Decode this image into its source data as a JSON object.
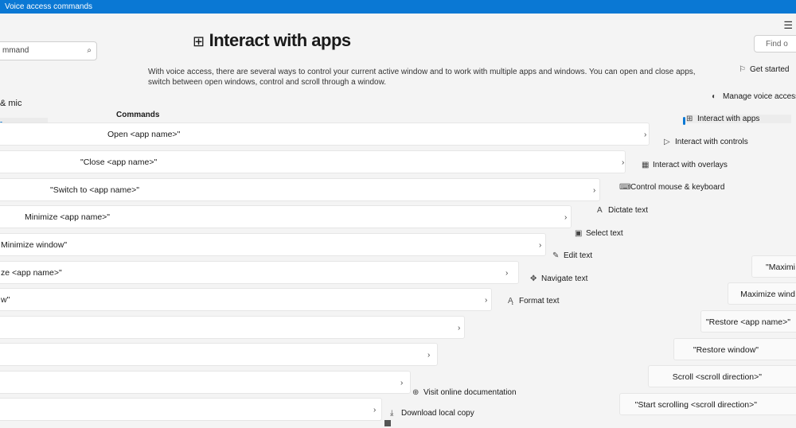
{
  "window": {
    "title": "Voice access commands"
  },
  "left": {
    "search_text": "mmand",
    "nav_item": "& mic"
  },
  "right": {
    "find_placeholder": "Find o"
  },
  "page": {
    "title": "Interact with apps",
    "description_line1": "With voice access, there are several ways to control your current active window and to work with multiple apps and windows. You can open and close apps,",
    "description_line2": "switch between open windows, control and scroll through a window.",
    "commands_header": "Commands"
  },
  "commands": [
    {
      "text": "Open <app name>\""
    },
    {
      "text": "\"Close <app name>\""
    },
    {
      "text": "\"Switch to <app name>\""
    },
    {
      "text": "Minimize <app name>\""
    },
    {
      "text": "Minimize window\""
    },
    {
      "text": "ze <app name>\""
    },
    {
      "text": "w\""
    },
    {
      "text": ""
    },
    {
      "text": ""
    },
    {
      "text": ""
    },
    {
      "text": ""
    }
  ],
  "commands_right": [
    {
      "text": "\"Maximi"
    },
    {
      "text": "Maximize wind"
    },
    {
      "text": "\"Restore <app name>\""
    },
    {
      "text": "\"Restore window\""
    },
    {
      "text": "Scroll <scroll direction>\""
    },
    {
      "text": "\"Start scrolling <scroll direction>\""
    }
  ],
  "toc": [
    {
      "label": "Get started",
      "icon": "flag-icon"
    },
    {
      "label": "Manage voice access",
      "icon": "mic-icon"
    },
    {
      "label": "Interact with apps",
      "icon": "apps-icon",
      "selected": true
    },
    {
      "label": "Interact with controls",
      "icon": "cursor-icon"
    },
    {
      "label": "Interact with overlays",
      "icon": "grid-icon"
    },
    {
      "label": "Control mouse & keyboard",
      "icon": "keyboard-icon"
    },
    {
      "label": "Dictate text",
      "icon": "dictate-icon"
    },
    {
      "label": "Select text",
      "icon": "select-text-icon"
    },
    {
      "label": "Edit text",
      "icon": "edit-icon"
    },
    {
      "label": "Navigate text",
      "icon": "navigate-icon"
    },
    {
      "label": "Format text",
      "icon": "format-icon"
    },
    {
      "label": "Visit online documentation",
      "icon": "globe-icon"
    },
    {
      "label": "Download local copy",
      "icon": "download-icon"
    }
  ]
}
